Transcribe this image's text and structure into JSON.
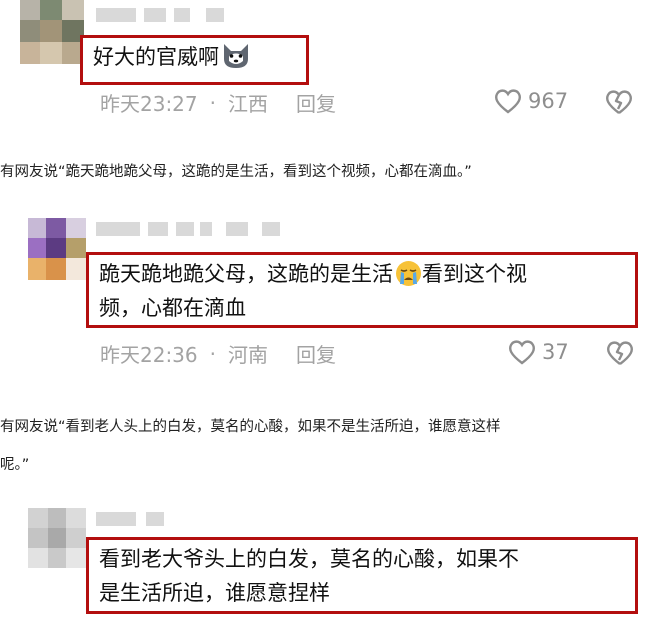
{
  "comments": [
    {
      "text": "好大的官威啊",
      "emoji": "husky-emoji-icon",
      "time": "昨天23:27",
      "location": "江西",
      "reply_label": "回复",
      "likes": "967"
    },
    {
      "text_line1": "跪天跪地跪父母，这跪的是生活",
      "emoji": "crying-face-emoji-icon",
      "text_line1_cont": "看到这个视",
      "text_line2": "频，心都在滴血",
      "time": "昨天22:36",
      "location": "河南",
      "reply_label": "回复",
      "likes": "37"
    },
    {
      "text_line1": "看到老大爷头上的白发，莫名的心酸，如果不",
      "text_line2": "是生活所迫，谁愿意捏样"
    }
  ],
  "quotes": [
    "有网友说“跪天跪地跪父母，这跪的是生活，看到这个视频，心都在滴血。”",
    "有网友说“看到老人头上的白发，莫名的心酸，如果不是生活所迫，谁愿意这样",
    "呢。”"
  ],
  "colors": {
    "highlight_border": "#b30e0e",
    "meta_text": "#a3a3a3"
  }
}
